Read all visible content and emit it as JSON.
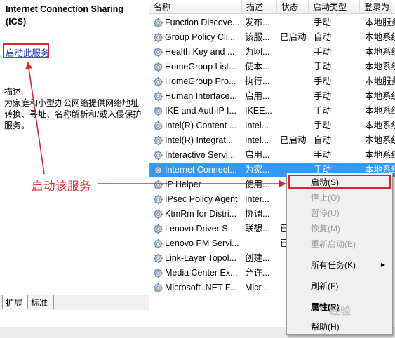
{
  "left_pane": {
    "title": "Internet Connection Sharing (ICS)",
    "start_link": "启动此服务",
    "description_label": "描述:",
    "description": "为家庭和小型办公网络提供网络地址转换、寻址、名称解析和/或入侵保护服务。"
  },
  "tabs": {
    "extended": "扩展",
    "standard": "标准"
  },
  "list": {
    "columns": {
      "name": "名称",
      "description": "描述",
      "status": "状态",
      "startup_type": "启动类型",
      "logon_as": "登录为"
    },
    "rows": [
      {
        "name": "Function Discove...",
        "description": "发布...",
        "status": "",
        "startup_type": "手动",
        "logon_as": "本地服务"
      },
      {
        "name": "Group Policy Cli...",
        "description": "该服...",
        "status": "已启动",
        "startup_type": "自动",
        "logon_as": "本地系统"
      },
      {
        "name": "Health Key and ...",
        "description": "为网...",
        "status": "",
        "startup_type": "手动",
        "logon_as": "本地系统"
      },
      {
        "name": "HomeGroup List...",
        "description": "使本...",
        "status": "",
        "startup_type": "手动",
        "logon_as": "本地系统"
      },
      {
        "name": "HomeGroup Pro...",
        "description": "执行...",
        "status": "",
        "startup_type": "手动",
        "logon_as": "本地服务"
      },
      {
        "name": "Human Interface...",
        "description": "启用...",
        "status": "",
        "startup_type": "手动",
        "logon_as": "本地系统"
      },
      {
        "name": "IKE and AuthIP I...",
        "description": "IKEE...",
        "status": "",
        "startup_type": "手动",
        "logon_as": "本地系统"
      },
      {
        "name": "Intel(R) Content ...",
        "description": "Intel...",
        "status": "",
        "startup_type": "手动",
        "logon_as": "本地系统"
      },
      {
        "name": "Intel(R) Integrat...",
        "description": "Intel...",
        "status": "已启动",
        "startup_type": "自动",
        "logon_as": "本地系统"
      },
      {
        "name": "Interactive Servi...",
        "description": "启用...",
        "status": "",
        "startup_type": "手动",
        "logon_as": "本地系统"
      },
      {
        "name": "Internet Connect...",
        "description": "为家...",
        "status": "",
        "startup_type": "手动",
        "logon_as": "本地系统"
      },
      {
        "name": "IP Helper",
        "description": "使用...",
        "status": "",
        "startup_type": "",
        "logon_as": ""
      },
      {
        "name": "IPsec Policy Agent",
        "description": "Inter...",
        "status": "",
        "startup_type": "",
        "logon_as": ""
      },
      {
        "name": "KtmRm for Distri...",
        "description": "协调...",
        "status": "",
        "startup_type": "",
        "logon_as": ""
      },
      {
        "name": "Lenovo Driver S...",
        "description": "联想...",
        "status": "已",
        "startup_type": "",
        "logon_as": ""
      },
      {
        "name": "Lenovo PM Servi...",
        "description": "",
        "status": "已",
        "startup_type": "",
        "logon_as": ""
      },
      {
        "name": "Link-Layer Topol...",
        "description": "创建...",
        "status": "",
        "startup_type": "",
        "logon_as": ""
      },
      {
        "name": "Media Center Ex...",
        "description": "允许...",
        "status": "",
        "startup_type": "",
        "logon_as": ""
      },
      {
        "name": "Microsoft .NET F...",
        "description": "Micr...",
        "status": "",
        "startup_type": "",
        "logon_as": ""
      }
    ]
  },
  "context_menu": {
    "start": "启动(S)",
    "stop": "停止(O)",
    "pause": "暂停(U)",
    "resume": "恢复(M)",
    "restart": "重新启动(E)",
    "all_tasks": "所有任务(K)",
    "refresh": "刷新(F)",
    "properties": "属性(R)",
    "help": "帮助(H)"
  },
  "annotation": {
    "label": "启动该服务"
  },
  "watermark": {
    "text": "经验"
  },
  "colors": {
    "annotation_red": "#d7262b",
    "selection_blue": "#3399ff",
    "link_blue": "#1a3cbb"
  }
}
